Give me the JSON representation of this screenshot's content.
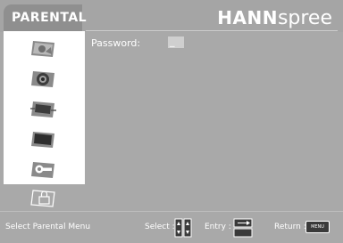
{
  "header": {
    "menu_title": "PARENTAL",
    "brand_bold": "HANN",
    "brand_light": "spree"
  },
  "sidebar": {
    "items": [
      {
        "id": "picture",
        "icon": "picture-icon"
      },
      {
        "id": "audio",
        "icon": "speaker-icon"
      },
      {
        "id": "screen",
        "icon": "screen-position-icon"
      },
      {
        "id": "tv",
        "icon": "tv-icon"
      },
      {
        "id": "setup",
        "icon": "wrench-icon"
      },
      {
        "id": "parental",
        "icon": "lock-icon",
        "selected": true
      }
    ]
  },
  "content": {
    "password_label": "Password:",
    "password_value": "_"
  },
  "footer": {
    "hint": "Select Parental Menu",
    "select_label": "Select :",
    "entry_label": "Entry :",
    "return_label": "Return :",
    "menu_key": "MENU"
  },
  "colors": {
    "background": "#a9a9a9",
    "title_tab": "#8f8f8f",
    "sidebar": "#ffffff",
    "text": "#ffffff"
  }
}
